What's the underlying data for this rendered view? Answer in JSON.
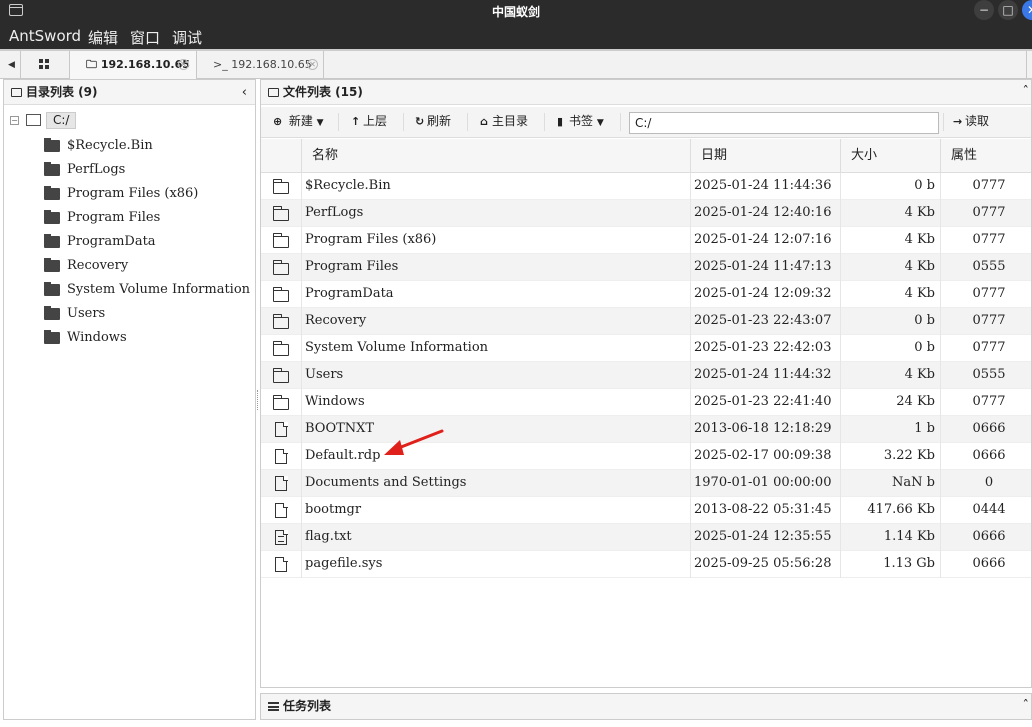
{
  "window": {
    "title": "中国蚁剑",
    "controls": [
      "−",
      "□",
      "✕"
    ]
  },
  "menu": [
    "AntSword",
    "编辑",
    "窗口",
    "调试"
  ],
  "tabs": [
    {
      "icon": "folder-icon",
      "label": "192.168.10.65",
      "active": true
    },
    {
      "icon": "terminal-icon",
      "prefix": ">_",
      "label": "192.168.10.65",
      "active": false
    }
  ],
  "dir_panel": {
    "title": "目录列表 (9)",
    "root": "C:/",
    "items": [
      "$Recycle.Bin",
      "PerfLogs",
      "Program Files (x86)",
      "Program Files",
      "ProgramData",
      "Recovery",
      "System Volume Information",
      "Users",
      "Windows"
    ]
  },
  "file_panel": {
    "title": "文件列表 (15)",
    "toolbar": {
      "new": "新建",
      "up": "上层",
      "refresh": "刷新",
      "home": "主目录",
      "bookmark": "书签",
      "path": "C:/",
      "read": "读取"
    },
    "columns": {
      "name": "名称",
      "date": "日期",
      "size": "大小",
      "attr": "属性"
    },
    "rows": [
      {
        "type": "folder",
        "name": "$Recycle.Bin",
        "date": "2025-01-24 11:44:36",
        "size": "0 b",
        "attr": "0777"
      },
      {
        "type": "folder",
        "name": "PerfLogs",
        "date": "2025-01-24 12:40:16",
        "size": "4 Kb",
        "attr": "0777"
      },
      {
        "type": "folder",
        "name": "Program Files (x86)",
        "date": "2025-01-24 12:07:16",
        "size": "4 Kb",
        "attr": "0777"
      },
      {
        "type": "folder",
        "name": "Program Files",
        "date": "2025-01-24 11:47:13",
        "size": "4 Kb",
        "attr": "0555"
      },
      {
        "type": "folder",
        "name": "ProgramData",
        "date": "2025-01-24 12:09:32",
        "size": "4 Kb",
        "attr": "0777"
      },
      {
        "type": "folder",
        "name": "Recovery",
        "date": "2025-01-23 22:43:07",
        "size": "0 b",
        "attr": "0777"
      },
      {
        "type": "folder",
        "name": "System Volume Information",
        "date": "2025-01-23 22:42:03",
        "size": "0 b",
        "attr": "0777"
      },
      {
        "type": "folder",
        "name": "Users",
        "date": "2025-01-24 11:44:32",
        "size": "4 Kb",
        "attr": "0555"
      },
      {
        "type": "folder",
        "name": "Windows",
        "date": "2025-01-23 22:41:40",
        "size": "24 Kb",
        "attr": "0777"
      },
      {
        "type": "file",
        "name": "BOOTNXT",
        "date": "2013-06-18 12:18:29",
        "size": "1 b",
        "attr": "0666"
      },
      {
        "type": "file",
        "name": "Default.rdp",
        "date": "2025-02-17 00:09:38",
        "size": "3.22 Kb",
        "attr": "0666"
      },
      {
        "type": "file",
        "name": "Documents and Settings",
        "date": "1970-01-01 00:00:00",
        "size": "NaN b",
        "attr": "0"
      },
      {
        "type": "file",
        "name": "bootmgr",
        "date": "2013-08-22 05:31:45",
        "size": "417.66 Kb",
        "attr": "0444"
      },
      {
        "type": "text-file",
        "name": "flag.txt",
        "date": "2025-01-24 12:35:55",
        "size": "1.14 Kb",
        "attr": "0666"
      },
      {
        "type": "file",
        "name": "pagefile.sys",
        "date": "2025-09-25 05:56:28",
        "size": "1.13 Gb",
        "attr": "0666"
      }
    ]
  },
  "task_panel": {
    "title": "任务列表"
  },
  "colors": {
    "titlebar": "#2b2b2b",
    "close_button": "#3b78e7",
    "annotation_arrow": "#e0201a"
  }
}
